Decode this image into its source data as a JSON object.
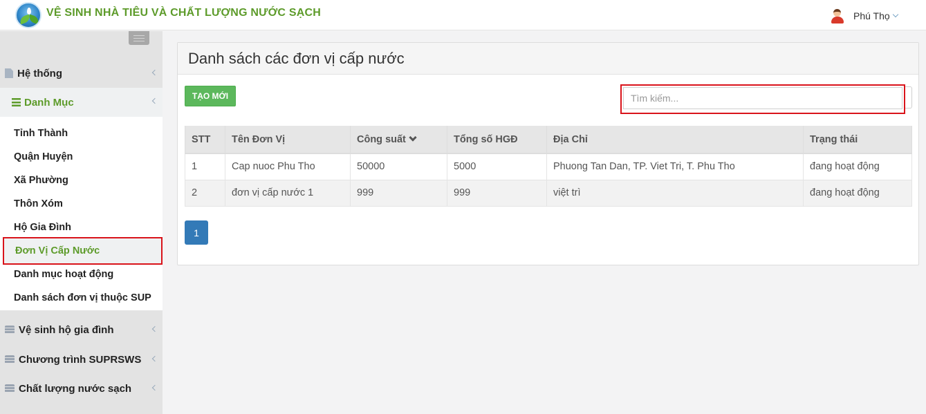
{
  "header": {
    "app_title": "VỆ SINH NHÀ TIÊU VÀ CHẤT LƯỢNG NƯỚC SẠCH",
    "user_name": "Phú Thọ"
  },
  "sidebar": {
    "groups": [
      {
        "label": "Hệ thống",
        "icon": "file-icon"
      },
      {
        "label": "Danh Mục",
        "icon": "bars-icon",
        "active": true
      },
      {
        "label": "Vệ sinh hộ gia đình",
        "icon": "database-icon"
      },
      {
        "label": "Chương trình SUPRSWS",
        "icon": "database-icon"
      },
      {
        "label": "Chất lượng nước sạch",
        "icon": "database-icon"
      }
    ],
    "submenu": [
      {
        "label": "Tỉnh Thành"
      },
      {
        "label": "Quận Huyện"
      },
      {
        "label": "Xã Phường"
      },
      {
        "label": "Thôn Xóm"
      },
      {
        "label": "Hộ Gia Đình"
      },
      {
        "label": "Đơn Vị Cấp Nước",
        "current": true
      },
      {
        "label": "Danh mục hoạt động"
      },
      {
        "label": "Danh sách đơn vị thuộc SUP"
      }
    ]
  },
  "main": {
    "title": "Danh sách các đơn vị cấp nước",
    "create_label": "TẠO MỚI",
    "search_placeholder": "Tìm kiếm...",
    "table": {
      "columns": [
        "STT",
        "Tên Đơn Vị",
        "Công suất",
        "Tổng số HGĐ",
        "Địa Chỉ",
        "Trạng thái"
      ],
      "rows": [
        [
          "1",
          "Cap nuoc Phu Tho",
          "50000",
          "5000",
          "Phuong Tan Dan, TP. Viet Tri, T. Phu Tho",
          "đang hoạt động"
        ],
        [
          "2",
          "đơn vị cấp nước 1",
          "999",
          "999",
          "việt trì",
          "đang hoạt động"
        ]
      ]
    },
    "pagination": {
      "current_page": "1"
    }
  },
  "colors": {
    "brand_green": "#5d9b2a",
    "button_green": "#5cb85c",
    "page_blue": "#337ab7",
    "highlight_red": "#d9131a"
  }
}
